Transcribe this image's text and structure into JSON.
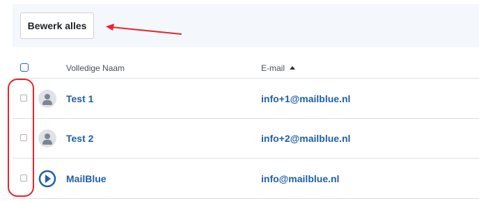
{
  "toolbar": {
    "edit_all_label": "Bewerk alles"
  },
  "table": {
    "columns": {
      "name": "Volledige Naam",
      "email": "E-mail"
    },
    "sort": {
      "column": "email",
      "direction": "ascending"
    },
    "rows": [
      {
        "name": "Test 1",
        "email": "info+1@mailblue.nl",
        "avatar": "person-icon"
      },
      {
        "name": "Test 2",
        "email": "info+2@mailblue.nl",
        "avatar": "person-icon"
      },
      {
        "name": "MailBlue",
        "email": "info@mailblue.nl",
        "avatar": "mailblue-logo-icon"
      }
    ]
  },
  "annotations": {
    "arrow_color": "#e8232b",
    "oval_color": "#e8232b"
  },
  "colors": {
    "link": "#1f5fa8",
    "toolbar_bg": "#f4f7fc",
    "checkbox_accent": "#1f66c6"
  }
}
